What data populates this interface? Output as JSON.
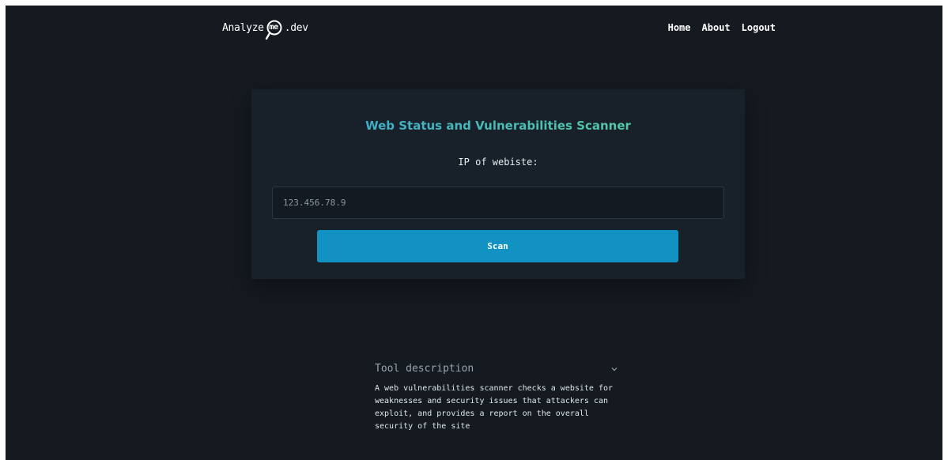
{
  "header": {
    "logo": {
      "prefix": "Analyze",
      "mark": "me",
      "suffix": ".dev"
    },
    "nav": [
      {
        "label": "Home"
      },
      {
        "label": "About"
      },
      {
        "label": "Logout"
      }
    ]
  },
  "scanner": {
    "title": "Web Status and Vulnerabilities Scanner",
    "field_label": "IP of webiste:",
    "ip_placeholder": "123.456.78.9",
    "ip_value": "",
    "scan_label": "Scan"
  },
  "description": {
    "title": "Tool description",
    "text": "A web vulnerabilities scanner checks a website for weaknesses and security issues that attackers can exploit, and provides a report on the overall security of the site",
    "expanded": true,
    "toggle_icon": "chevron-down-icon"
  },
  "colors": {
    "background": "#141a20",
    "card": "#18212a",
    "accent": "#1192c3",
    "title_gradient_start": "#3aa0d8",
    "title_gradient_end": "#5fd49a"
  }
}
